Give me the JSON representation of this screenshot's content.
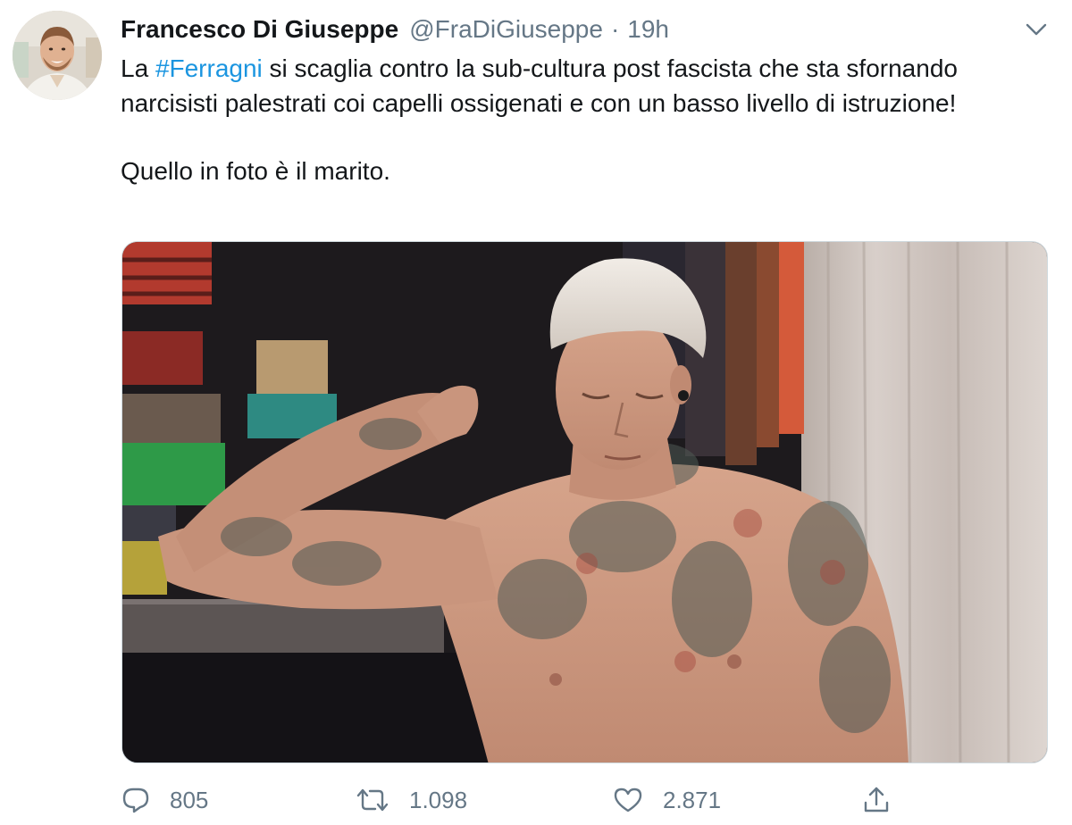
{
  "tweet": {
    "author_name": "Francesco Di Giuseppe",
    "handle": "@FraDiGiuseppe",
    "separator": "·",
    "time": "19h",
    "text_prefix": "La ",
    "hashtag": "#Ferragni",
    "text_main": " si scaglia contro la sub-cultura post fascista che sta sfornando narcisisti palestrati coi capelli ossigenati e con un basso livello di istruzione!",
    "text_second": "Quello in foto è il marito."
  },
  "icons": {
    "more": "chevron-down-icon",
    "reply": "reply-icon",
    "retweet": "retweet-icon",
    "like": "heart-icon",
    "share": "share-icon"
  },
  "actions": {
    "replies": "805",
    "retweets": "1.098",
    "likes": "2.871"
  },
  "colors": {
    "hashtag": "#1b95e0",
    "secondary_text": "#657786",
    "primary_text": "#14171a"
  }
}
